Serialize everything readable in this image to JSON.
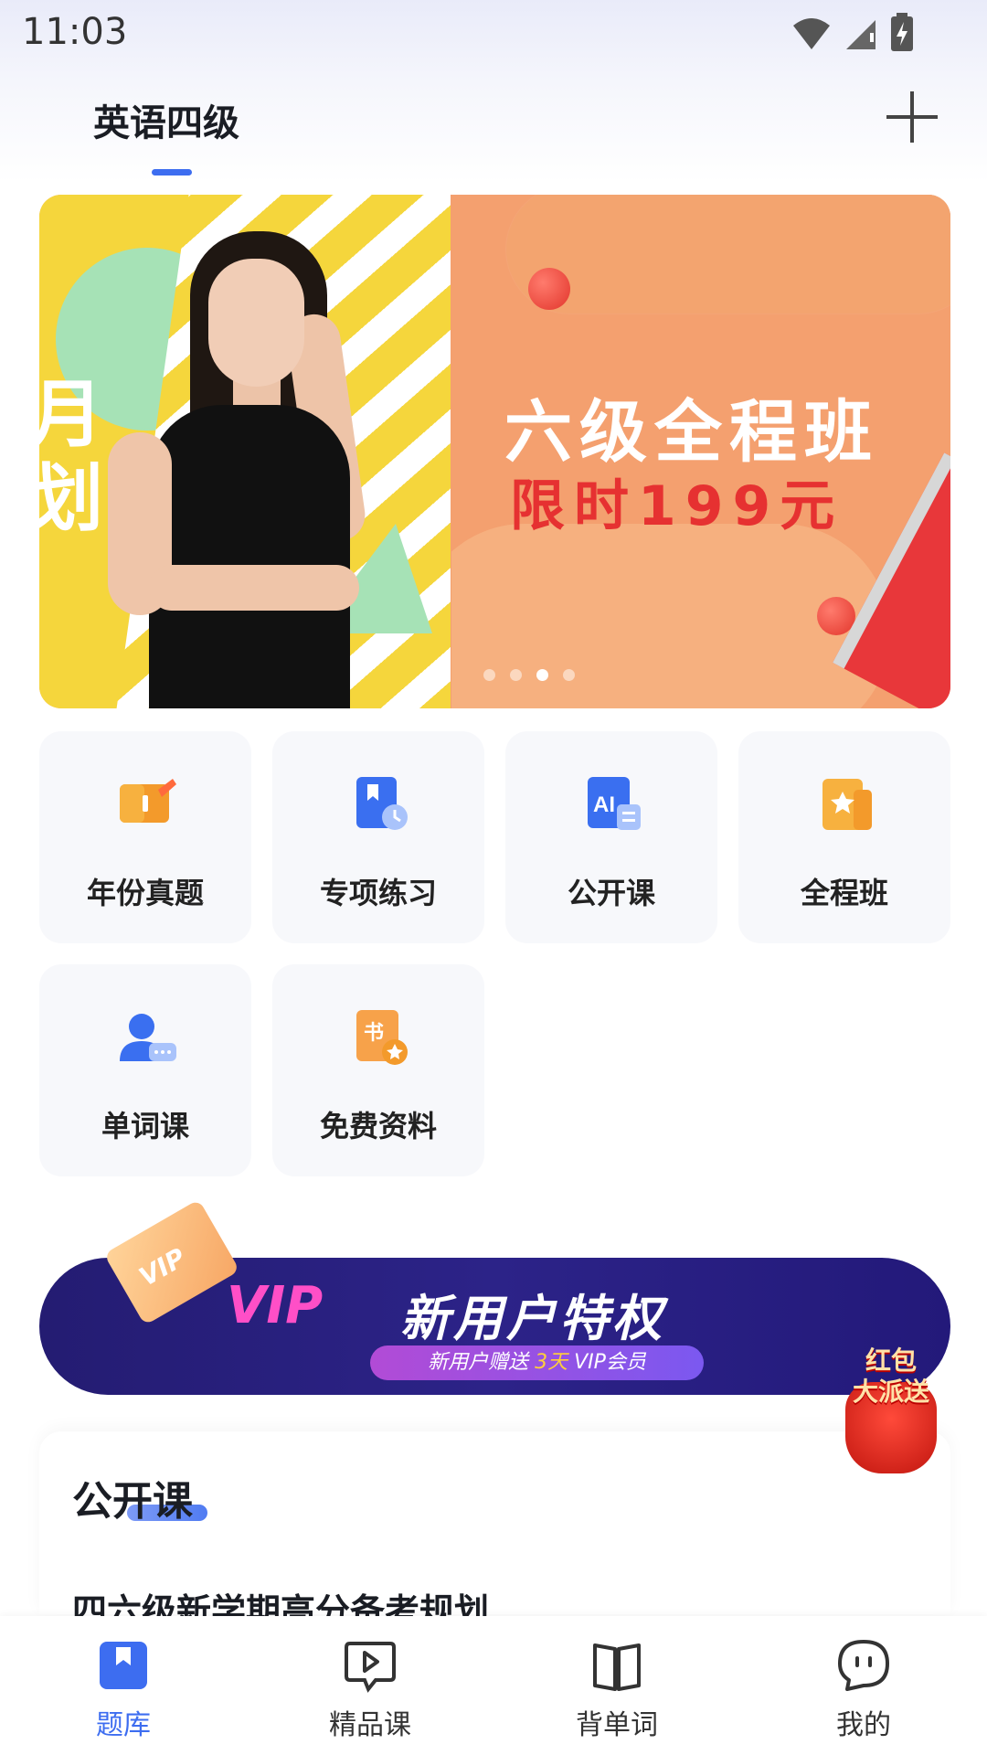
{
  "status_bar": {
    "time": "11:03"
  },
  "header": {
    "tab_label": "英语四级"
  },
  "banner": {
    "left_edge_text": "月\n划",
    "title": "六级全程班",
    "subtitle": "限时199元",
    "dots_total": 4,
    "active_dot": 3
  },
  "features": [
    {
      "label": "年份真题",
      "icon": "book-icon"
    },
    {
      "label": "专项练习",
      "icon": "bookmark-clock-icon"
    },
    {
      "label": "公开课",
      "icon": "ai-doc-icon"
    },
    {
      "label": "全程班",
      "icon": "star-box-icon"
    },
    {
      "label": "单词课",
      "icon": "user-chat-icon"
    },
    {
      "label": "免费资料",
      "icon": "book-star-icon"
    }
  ],
  "promo": {
    "card_text": "VIP",
    "swoosh_text": "VIP",
    "title": "新用户特权",
    "pill_prefix": "新用户赠送",
    "pill_highlight": "3天",
    "pill_suffix": "VIP会员"
  },
  "red_packet": {
    "line1": "红包",
    "line2": "大派送"
  },
  "section": {
    "title": "公开课",
    "course_title": "四六级新学期高分备考规划"
  },
  "bottom_nav": [
    {
      "label": "题库",
      "icon": "question-bank-icon",
      "active": true
    },
    {
      "label": "精品课",
      "icon": "play-chat-icon",
      "active": false
    },
    {
      "label": "背单词",
      "icon": "open-book-icon",
      "active": false
    },
    {
      "label": "我的",
      "icon": "smile-chat-icon",
      "active": false
    }
  ],
  "colors": {
    "accent": "#3d6df0",
    "banner_yellow": "#f5d63c",
    "banner_orange": "#f4a06f",
    "promo_navy": "#241c72"
  }
}
